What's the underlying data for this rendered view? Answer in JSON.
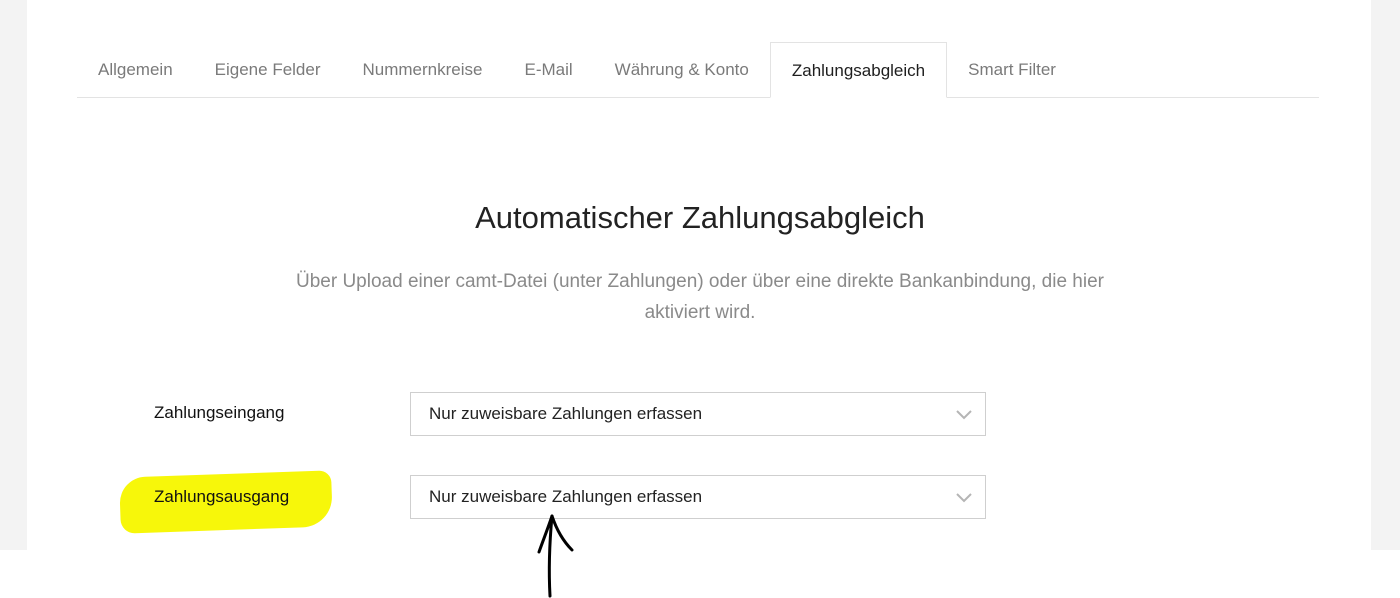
{
  "tabs": [
    {
      "label": "Allgemein",
      "active": false
    },
    {
      "label": "Eigene Felder",
      "active": false
    },
    {
      "label": "Nummernkreise",
      "active": false
    },
    {
      "label": "E-Mail",
      "active": false
    },
    {
      "label": "Währung & Konto",
      "active": false
    },
    {
      "label": "Zahlungsabgleich",
      "active": true
    },
    {
      "label": "Smart Filter",
      "active": false
    }
  ],
  "section": {
    "title": "Automatischer Zahlungsabgleich",
    "description": "Über Upload einer camt-Datei (unter Zahlungen) oder über eine direkte Bankanbindung, die hier aktiviert wird."
  },
  "fields": {
    "incoming": {
      "label": "Zahlungseingang",
      "value": "Nur zuweisbare Zahlungen erfassen"
    },
    "outgoing": {
      "label": "Zahlungsausgang",
      "value": "Nur zuweisbare Zahlungen erfassen"
    }
  },
  "colors": {
    "highlight": "#f7f70a",
    "background_side": "#f3f3f3"
  },
  "icons": {
    "select_chevron": "chevron-down-icon",
    "annotation": "arrow-up-annotation"
  }
}
